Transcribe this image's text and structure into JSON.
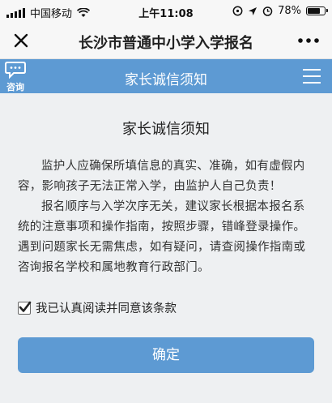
{
  "status_bar": {
    "carrier": "中国移动",
    "time": "上午11:08",
    "battery_text": "78%",
    "battery_level": 0.78,
    "icons": [
      "signal-icon",
      "wifi-icon",
      "alarm-icon",
      "location-icon",
      "alarm-clock-icon",
      "battery-icon"
    ]
  },
  "nav_bar": {
    "title": "长沙市普通中小学入学报名",
    "close_icon": "close-icon",
    "more_icon": "more-icon"
  },
  "header": {
    "title": "家长诚信须知",
    "consult_label": "咨询",
    "menu_icon": "hamburger-menu-icon",
    "color": "#5d9ad3"
  },
  "notice": {
    "title": "家长诚信须知",
    "paragraphs": [
      "监护人应确保所填信息的真实、准确，如有虚假内容，影响孩子无法正常入学，由监护人自己负责！",
      "报名顺序与入学次序无关，建议家长根据本报名系统的注意事项和操作指南，按照步骤，错峰登录操作。遇到问题家长无需焦虑，如有疑问，请查阅操作指南或咨询报名学校和属地教育行政部门。"
    ]
  },
  "agreement": {
    "checked": true,
    "label": "我已认真阅读并同意该条款"
  },
  "confirm_button": {
    "label": "确定"
  }
}
